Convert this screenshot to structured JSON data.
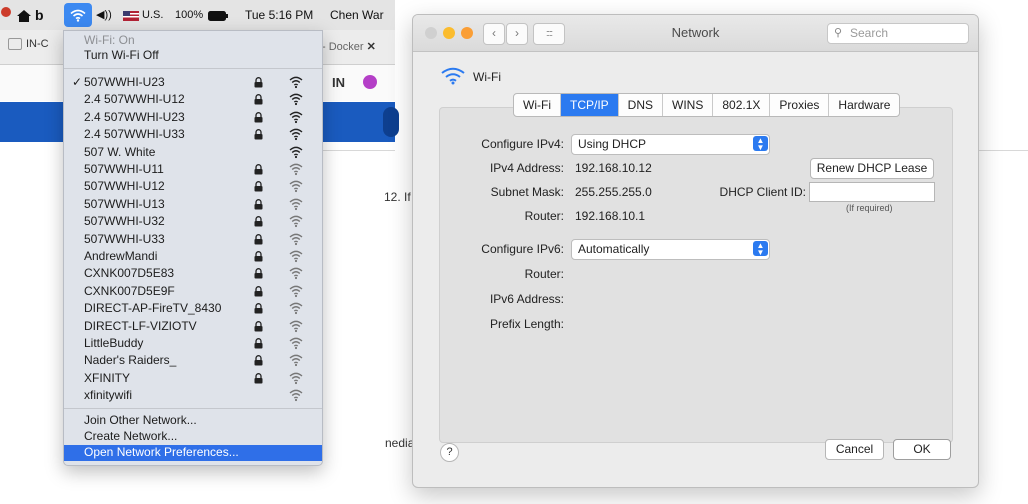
{
  "menubar": {
    "input_source": "U.S.",
    "battery": "100%",
    "clock": "Tue 5:16 PM",
    "user": "Chen War"
  },
  "browser": {
    "tab_left": "IN-C",
    "tab_right": "- Docker",
    "tab_close": "✕",
    "ext_icon": "IN",
    "fragment_1": "12. If",
    "fragment_2": "nedia"
  },
  "wifi_menu": {
    "status": "Wi-Fi: On",
    "turn_off": "Turn Wi-Fi Off",
    "networks": [
      {
        "name": "507WWHI-U23",
        "locked": true,
        "connected": true
      },
      {
        "name": "2.4 507WWHI-U12",
        "locked": true
      },
      {
        "name": "2.4 507WWHI-U23",
        "locked": true
      },
      {
        "name": "2.4 507WWHI-U33",
        "locked": true
      },
      {
        "name": "507 W. White",
        "locked": false
      },
      {
        "name": "507WWHI-U11",
        "locked": true
      },
      {
        "name": "507WWHI-U12",
        "locked": true
      },
      {
        "name": "507WWHI-U13",
        "locked": true
      },
      {
        "name": "507WWHI-U32",
        "locked": true
      },
      {
        "name": "507WWHI-U33",
        "locked": true
      },
      {
        "name": "AndrewMandi",
        "locked": true
      },
      {
        "name": "CXNK007D5E83",
        "locked": true
      },
      {
        "name": "CXNK007D5E9F",
        "locked": true
      },
      {
        "name": "DIRECT-AP-FireTV_8430",
        "locked": true
      },
      {
        "name": "DIRECT-LF-VIZIOTV",
        "locked": true
      },
      {
        "name": "LittleBuddy",
        "locked": true
      },
      {
        "name": "Nader's Raiders_",
        "locked": true
      },
      {
        "name": "XFINITY",
        "locked": true
      },
      {
        "name": "xfinitywifi",
        "locked": false
      }
    ],
    "join_other": "Join Other Network...",
    "create_network": "Create Network...",
    "open_prefs": "Open Network Preferences..."
  },
  "network_window": {
    "title": "Network",
    "search_placeholder": "Search",
    "interface": "Wi-Fi",
    "tabs": [
      "Wi-Fi",
      "TCP/IP",
      "DNS",
      "WINS",
      "802.1X",
      "Proxies",
      "Hardware"
    ],
    "active_tab": "TCP/IP",
    "configure_ipv4_label": "Configure IPv4:",
    "configure_ipv4_value": "Using DHCP",
    "ipv4_address_label": "IPv4 Address:",
    "ipv4_address": "192.168.10.12",
    "subnet_mask_label": "Subnet Mask:",
    "subnet_mask": "255.255.255.0",
    "router_label": "Router:",
    "router": "192.168.10.1",
    "renew_button": "Renew DHCP Lease",
    "dhcp_client_id_label": "DHCP Client ID:",
    "dhcp_client_id": "",
    "if_required": "(If required)",
    "configure_ipv6_label": "Configure IPv6:",
    "configure_ipv6_value": "Automatically",
    "router6_label": "Router:",
    "ipv6_address_label": "IPv6 Address:",
    "prefix_length_label": "Prefix Length:",
    "help": "?",
    "cancel": "Cancel",
    "ok": "OK"
  },
  "colors": {
    "accent": "#2b7af0",
    "menu_highlight": "#2f6fe8",
    "browser_bar": "#1a5bbf",
    "traffic_red": "#f95f57",
    "traffic_yellow": "#fbbc2e",
    "traffic_green": "#c9c9c9"
  }
}
